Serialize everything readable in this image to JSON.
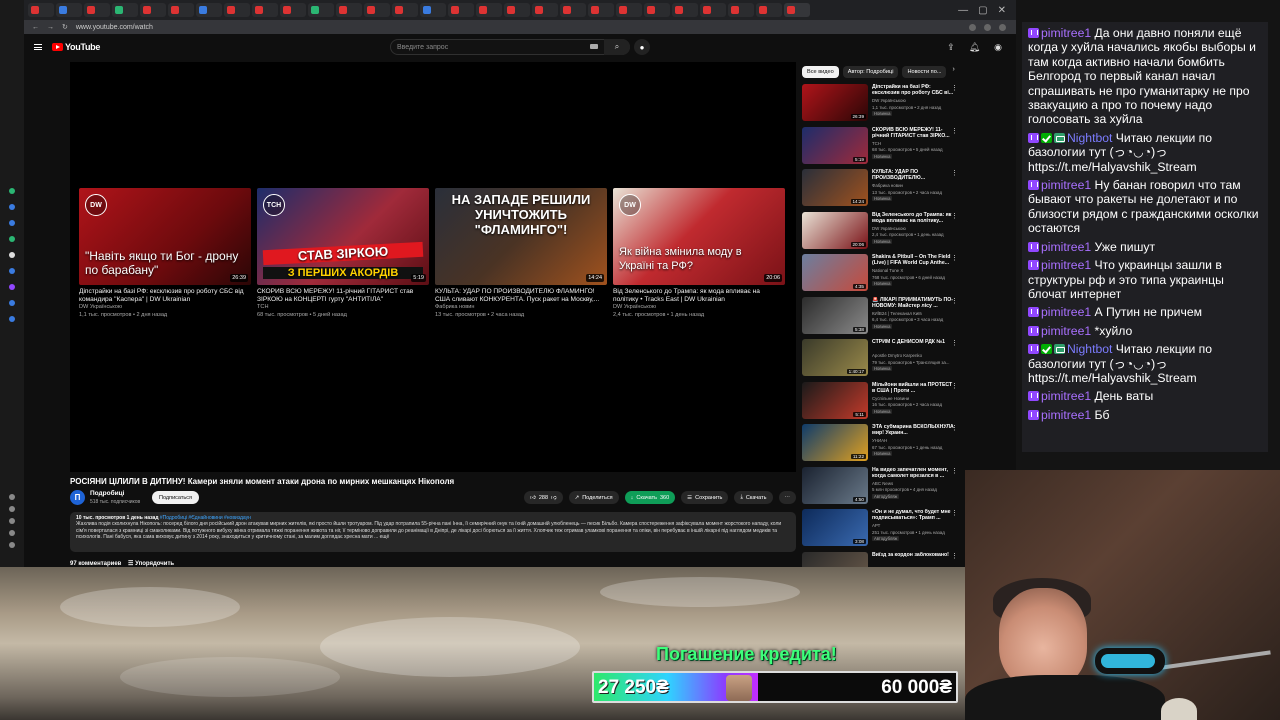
{
  "browser": {
    "url": "www.youtube.com/watch",
    "window_controls": [
      "—",
      "▢",
      "✕"
    ]
  },
  "header": {
    "logo_text": "YouTube",
    "search_placeholder": "Введите запрос"
  },
  "endscreen": [
    {
      "title": "Діпстрайки на базі РФ: ексклюзив про роботу СБС від командира \"Каспера\" | DW Ukrainian",
      "channel": "DW Українською",
      "meta": "1,1 тыс. просмотров • 2 дня назад",
      "duration": "26:39",
      "caption": "\"Навіть якщо ти Бог - дрону по барабану\"",
      "logo": "DW",
      "bg": "linear-gradient(135deg,#b0141a 0%,#6d0a0d 60%,#2b0606 100%)"
    },
    {
      "title": "СКОРИВ ВСЮ МЕРЕЖУ! 11-річний ГІТАРИСТ став ЗІРКОЮ на КОНЦЕРТІ гурту \"АНТИТІЛА\"",
      "channel": "ТСН",
      "meta": "68 тыс. просмотров • 5 дней назад",
      "duration": "5:19",
      "caption": "СТАВ ЗІРКОЮ",
      "caption2": "З ПЕРШИХ АКОРДІВ",
      "logo": "ТСН",
      "bg": "linear-gradient(135deg,#1d2d6b 0%,#a02a3a 55%,#5c0e14 100%)"
    },
    {
      "title": "КУЛЬТА: УДАР ПО ПРОИЗВОДИТЕЛЮ ФЛАМИНГО! США сливают КОНКУРЕНТА. Пуск ракет на Москву,...",
      "channel": "Фабрика новин",
      "meta": "13 тыс. просмотров • 2 часа назад",
      "duration": "14:24",
      "caption": "НА ЗАПАДЕ РЕШИЛИ УНИЧТОЖИТЬ \"ФЛАМИНГО\"!",
      "bg": "linear-gradient(135deg,#2a2f3a 0%,#4a3324 50%,#a0521e 100%)"
    },
    {
      "title": "Від Зеленського до Трампа: як мода впливає на політику • Tracks East | DW Ukrainian",
      "channel": "DW Українською",
      "meta": "2,4 тыс. просмотров • 1 день назад",
      "duration": "20:06",
      "caption": "Як війна змінила моду в Україні та РФ?",
      "logo": "DW",
      "bg": "linear-gradient(135deg,#e9e3d6 0%,#c02a2f 45%,#7a1217 100%)"
    }
  ],
  "video": {
    "title": "РОСІЯНИ ЦІЛИЛИ В ДИТИНУ! Камери зняли момент атаки дрона по мирних мешканцях Нікополя",
    "channel_name": "Подробиці",
    "channel_initial": "П",
    "subscribers": "518 тыс. подписчиков",
    "subscribe_label": "Подписаться",
    "likes": "288",
    "share_label": "Поделиться",
    "download_green_label": "Скачать",
    "quality_label": "360",
    "save_label": "Сохранить",
    "download_label": "Скачать",
    "desc_stats": "10 тыс. просмотров  1 день назад",
    "desc_tags": "#Подробиці #Єднайновини #новиздаун",
    "description": "Жахлива подія сколихнула Нікополь: посеред білого дня російський дрон атакував мирних жителів, які просто йшли тротуаром. Під удар потрапила 55-річна пані Інна, її семирічний онук та їхній домашній улюбленець — песик Більбо. Камера спостереження зафіксувала момент жорстокого нападу, коли сім'я поверталася з крамниці зі смаколиками. Від потужного вибуху жінка отримала тяжкі поранення живота та ніг, її терміново доправили до реанімації в Дніпрі, де лікарі досі борються за її життя. Хлопчик теж отримав уламкові поранення та опіки, він перебуває в іншій лікарні під наглядом медиків та психологів. Пані бабуся, яка сама виховує дитину з 2014 року, знаходиться у критичному стані, за малим доглядає хресна мати ...",
    "desc_more": "ещё",
    "comments_count": "97 комментариев",
    "sort_label": "Упорядочить"
  },
  "recs": {
    "chips": [
      "Все видео",
      "Автор: Подробиці",
      "Новости по..."
    ],
    "items": [
      {
        "title": "Діпстрайки на базі РФ: ексклюзив про роботу СБС ві...",
        "channel": "DW Українською",
        "meta": "1,1 тыс. просмотров • 2 дня назад",
        "badge": "Новинка",
        "duration": "26:39",
        "bg": "linear-gradient(135deg,#b0141a,#2b0606)"
      },
      {
        "title": "СКОРИВ ВСЮ МЕРЕЖУ! 11-річний ГІТАРИСТ став ЗІРКО...",
        "channel": "ТСН",
        "meta": "68 тыс. просмотров • 5 дней назад",
        "badge": "Новинка",
        "duration": "5:19",
        "bg": "linear-gradient(135deg,#1d2d6b,#a02a3a)"
      },
      {
        "title": "КУЛЬТА: УДАР ПО ПРОИЗВОДИТЕЛЮ...",
        "channel": "Фабрика новин",
        "meta": "13 тыс. просмотров • 2 часа назад",
        "badge": "Новинка",
        "duration": "14:24",
        "bg": "linear-gradient(135deg,#2a2f3a,#a0521e)"
      },
      {
        "title": "Від Зеленського до Трампа: як мода впливає на політику...",
        "channel": "DW Українською",
        "meta": "2,4 тыс. просмотров • 1 день назад",
        "badge": "Новинка",
        "duration": "20:06",
        "bg": "linear-gradient(135deg,#e9e3d6,#7a1217)"
      },
      {
        "title": "Shakira & Pitbull – On The Field (Live) | FIFA World Cup Anthe...",
        "channel": "National Tune X",
        "meta": "768 тыс. просмотров • 6 дней назад",
        "badge": "Новинка",
        "duration": "4:35",
        "bg": "linear-gradient(135deg,#6b7fa0,#c64a3b)"
      },
      {
        "title": "🚨 ЛІКАРІ ПРИЙМАТИМУТЬ ПО-НОВОМУ: Майстер лісу ...",
        "channel": "КИЇВ24 | Телеканал Київ",
        "meta": "6,4 тыс. просмотров • 3 часа назад",
        "badge": "Новинка",
        "duration": "5:38",
        "bg": "linear-gradient(135deg,#2c2c2c,#8a8a8a)"
      },
      {
        "title": "СТРИМ С ДЕНИСОМ РДК №1",
        "channel": "Apostle Dmytro Karpenko",
        "meta": "79 тыс. просмотров • Трансляция за...",
        "badge": "Новинка",
        "duration": "1:40:17",
        "bg": "linear-gradient(135deg,#3a3a2a,#9a8a4a)"
      },
      {
        "title": "Мільйони вийшли на ПРОТЕСТ в США | Проти ...",
        "channel": "Суспільне Новини",
        "meta": "16 тыс. просмотров • 2 часа назад",
        "badge": "Новинка",
        "duration": "5:11",
        "bg": "linear-gradient(135deg,#1a1a1a,#c43a2a)"
      },
      {
        "title": "ЭТА субмарина ВСКОЛЫХНУЛА мир! Украин...",
        "channel": "УНИАН",
        "meta": "67 тыс. просмотров • 1 день назад",
        "badge": "Новинка",
        "duration": "11:22",
        "bg": "linear-gradient(135deg,#0e3b6b,#e0a020)"
      },
      {
        "title": "На видео запечатлен момент, когда самолет врезался в ...",
        "channel": "ABC News",
        "meta": "5 млн просмотров • 4 дня назад",
        "badge": "Автодубляж",
        "duration": "4:50",
        "bg": "linear-gradient(135deg,#1a2230,#6a7a8a)"
      },
      {
        "title": "«Он и не думал, что будет мне подписываться»: Трамп ...",
        "channel": "АРТ",
        "meta": "251 тыс. просмотров • 1 день назад",
        "badge": "Автодубляж",
        "duration": "3:08",
        "bg": "linear-gradient(135deg,#0d2a5a,#3a6ab0)"
      },
      {
        "title": "Виїзд за кордон заблоковано!",
        "channel": "",
        "meta": "",
        "badge": "",
        "duration": "",
        "bg": "linear-gradient(135deg,#2a2a2a,#6a5a4a)"
      }
    ]
  },
  "chat": [
    {
      "user": "pimitree1",
      "icons": [
        "twitch-icon"
      ],
      "text": "Да они давно поняли ещё когда у хуйла начались якобы выборы и там когда активно начали бомбить Белгород то первый канал начал спрашивать не про гуманитарку не про звакуацию а про то почему надо голосовать за хуйла"
    },
    {
      "user": "Nightbot",
      "icons": [
        "twitch-icon",
        "check-icon",
        "robot-icon"
      ],
      "text": "Читаю лекции по базологии тут (っ◔◡◔)っ https://t.me/Halyavshik_Stream"
    },
    {
      "user": "pimitree1",
      "icons": [
        "twitch-icon"
      ],
      "text": "Ну банан говорил что там бывают что ракеты не долетают и по близости рядом с гражданскими осколки остаются"
    },
    {
      "user": "pimitree1",
      "icons": [
        "twitch-icon"
      ],
      "text": "Уже пишут"
    },
    {
      "user": "pimitree1",
      "icons": [
        "twitch-icon"
      ],
      "text": "Что украинцы зашли в структуры рф и это типа украинцы блочат интернет"
    },
    {
      "user": "pimitree1",
      "icons": [
        "twitch-icon"
      ],
      "text": "А Путин не причем"
    },
    {
      "user": "pimitree1",
      "icons": [
        "twitch-icon"
      ],
      "text": "*хуйло"
    },
    {
      "user": "Nightbot",
      "icons": [
        "twitch-icon",
        "check-icon",
        "robot-icon"
      ],
      "text": "Читаю лекции по базологии тут (っ◔◡◔)っ https://t.me/Halyavshik_Stream"
    },
    {
      "user": "pimitree1",
      "icons": [
        "twitch-icon"
      ],
      "text": "День ваты"
    },
    {
      "user": "pimitree1",
      "icons": [
        "twitch-icon"
      ],
      "text": "Бб"
    }
  ],
  "donation": {
    "title": "Погашение кредита!",
    "current": "27 250₴",
    "goal": "60 000₴",
    "progress": 0.454
  },
  "colors": {
    "youtube_bg": "#0f0f0f",
    "chat_bg": "#1f1f23",
    "twitch_purple": "#9147ff",
    "pimitree_color": "#a970ff",
    "nightbot_color": "#7c7cff",
    "donation_green": "#3dff7a"
  }
}
